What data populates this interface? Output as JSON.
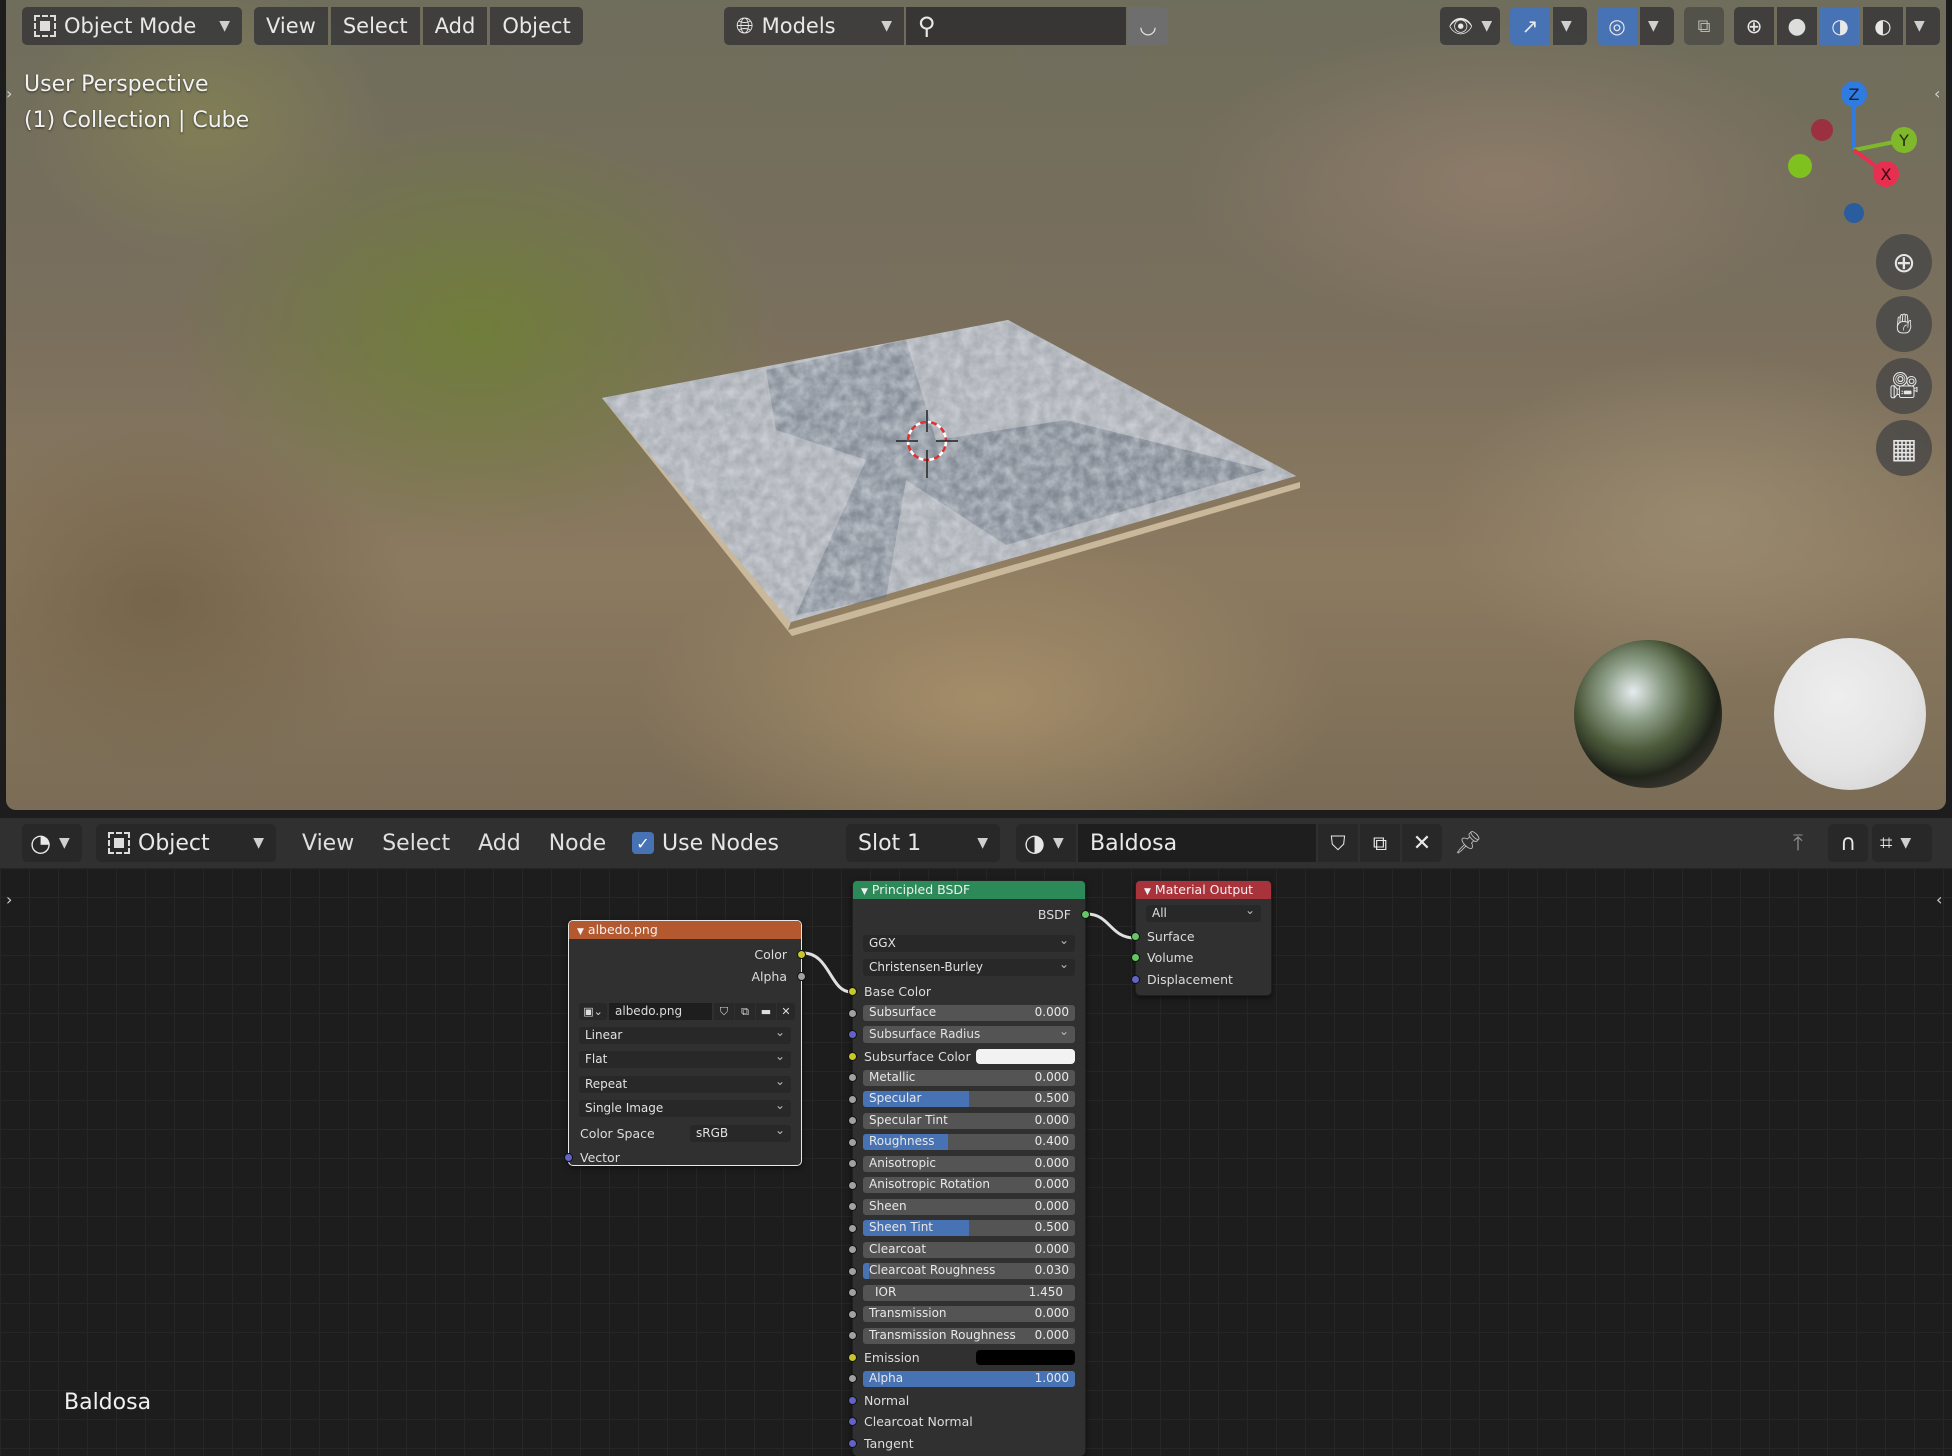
{
  "viewport": {
    "mode_label": "Object Mode",
    "menus": [
      "View",
      "Select",
      "Add",
      "Object"
    ],
    "orientation_label": "Models",
    "overlay_line1": "User Perspective",
    "overlay_line2": "(1) Collection | Cube",
    "gizmo": {
      "x": "X",
      "y": "Y",
      "z": "Z"
    }
  },
  "node_editor": {
    "editor_type_label": "Object",
    "menus": [
      "View",
      "Select",
      "Add",
      "Node"
    ],
    "use_nodes_label": "Use Nodes",
    "use_nodes_checked": true,
    "slot_label": "Slot 1",
    "material_name": "Baldosa",
    "footer_label": "Baldosa"
  },
  "image_node": {
    "title": "albedo.png",
    "out_color": "Color",
    "out_alpha": "Alpha",
    "image_name": "albedo.png",
    "interpolation": "Linear",
    "projection": "Flat",
    "extension": "Repeat",
    "source": "Single Image",
    "color_space_label": "Color Space",
    "color_space": "sRGB",
    "vector_label": "Vector"
  },
  "bsdf_node": {
    "title": "Principled BSDF",
    "output": "BSDF",
    "distribution": "GGX",
    "subsurface_method": "Christensen-Burley",
    "base_color_label": "Base Color",
    "subsurface_label": "Subsurface",
    "subsurface": "0.000",
    "subsurface_radius_label": "Subsurface Radius",
    "subsurface_color_label": "Subsurface Color",
    "metallic_label": "Metallic",
    "metallic": "0.000",
    "specular_label": "Specular",
    "specular": "0.500",
    "specular_tint_label": "Specular Tint",
    "specular_tint": "0.000",
    "roughness_label": "Roughness",
    "roughness": "0.400",
    "anisotropic_label": "Anisotropic",
    "anisotropic": "0.000",
    "anisotropic_rotation_label": "Anisotropic Rotation",
    "anisotropic_rotation": "0.000",
    "sheen_label": "Sheen",
    "sheen": "0.000",
    "sheen_tint_label": "Sheen Tint",
    "sheen_tint": "0.500",
    "clearcoat_label": "Clearcoat",
    "clearcoat": "0.000",
    "clearcoat_roughness_label": "Clearcoat Roughness",
    "clearcoat_roughness": "0.030",
    "ior_label": "IOR",
    "ior": "1.450",
    "transmission_label": "Transmission",
    "transmission": "0.000",
    "transmission_roughness_label": "Transmission Roughness",
    "transmission_roughness": "0.000",
    "emission_label": "Emission",
    "alpha_label": "Alpha",
    "alpha": "1.000",
    "normal_label": "Normal",
    "clearcoat_normal_label": "Clearcoat Normal",
    "tangent_label": "Tangent"
  },
  "output_node": {
    "title": "Material Output",
    "target": "All",
    "surface_label": "Surface",
    "volume_label": "Volume",
    "displacement_label": "Displacement"
  },
  "colors": {
    "accent": "#4772b3",
    "image_header": "#b4592f",
    "bsdf_header": "#2b8a57",
    "output_header": "#a8333b",
    "subsurface_color": "#f2f2f2",
    "emission_color": "#000000"
  }
}
